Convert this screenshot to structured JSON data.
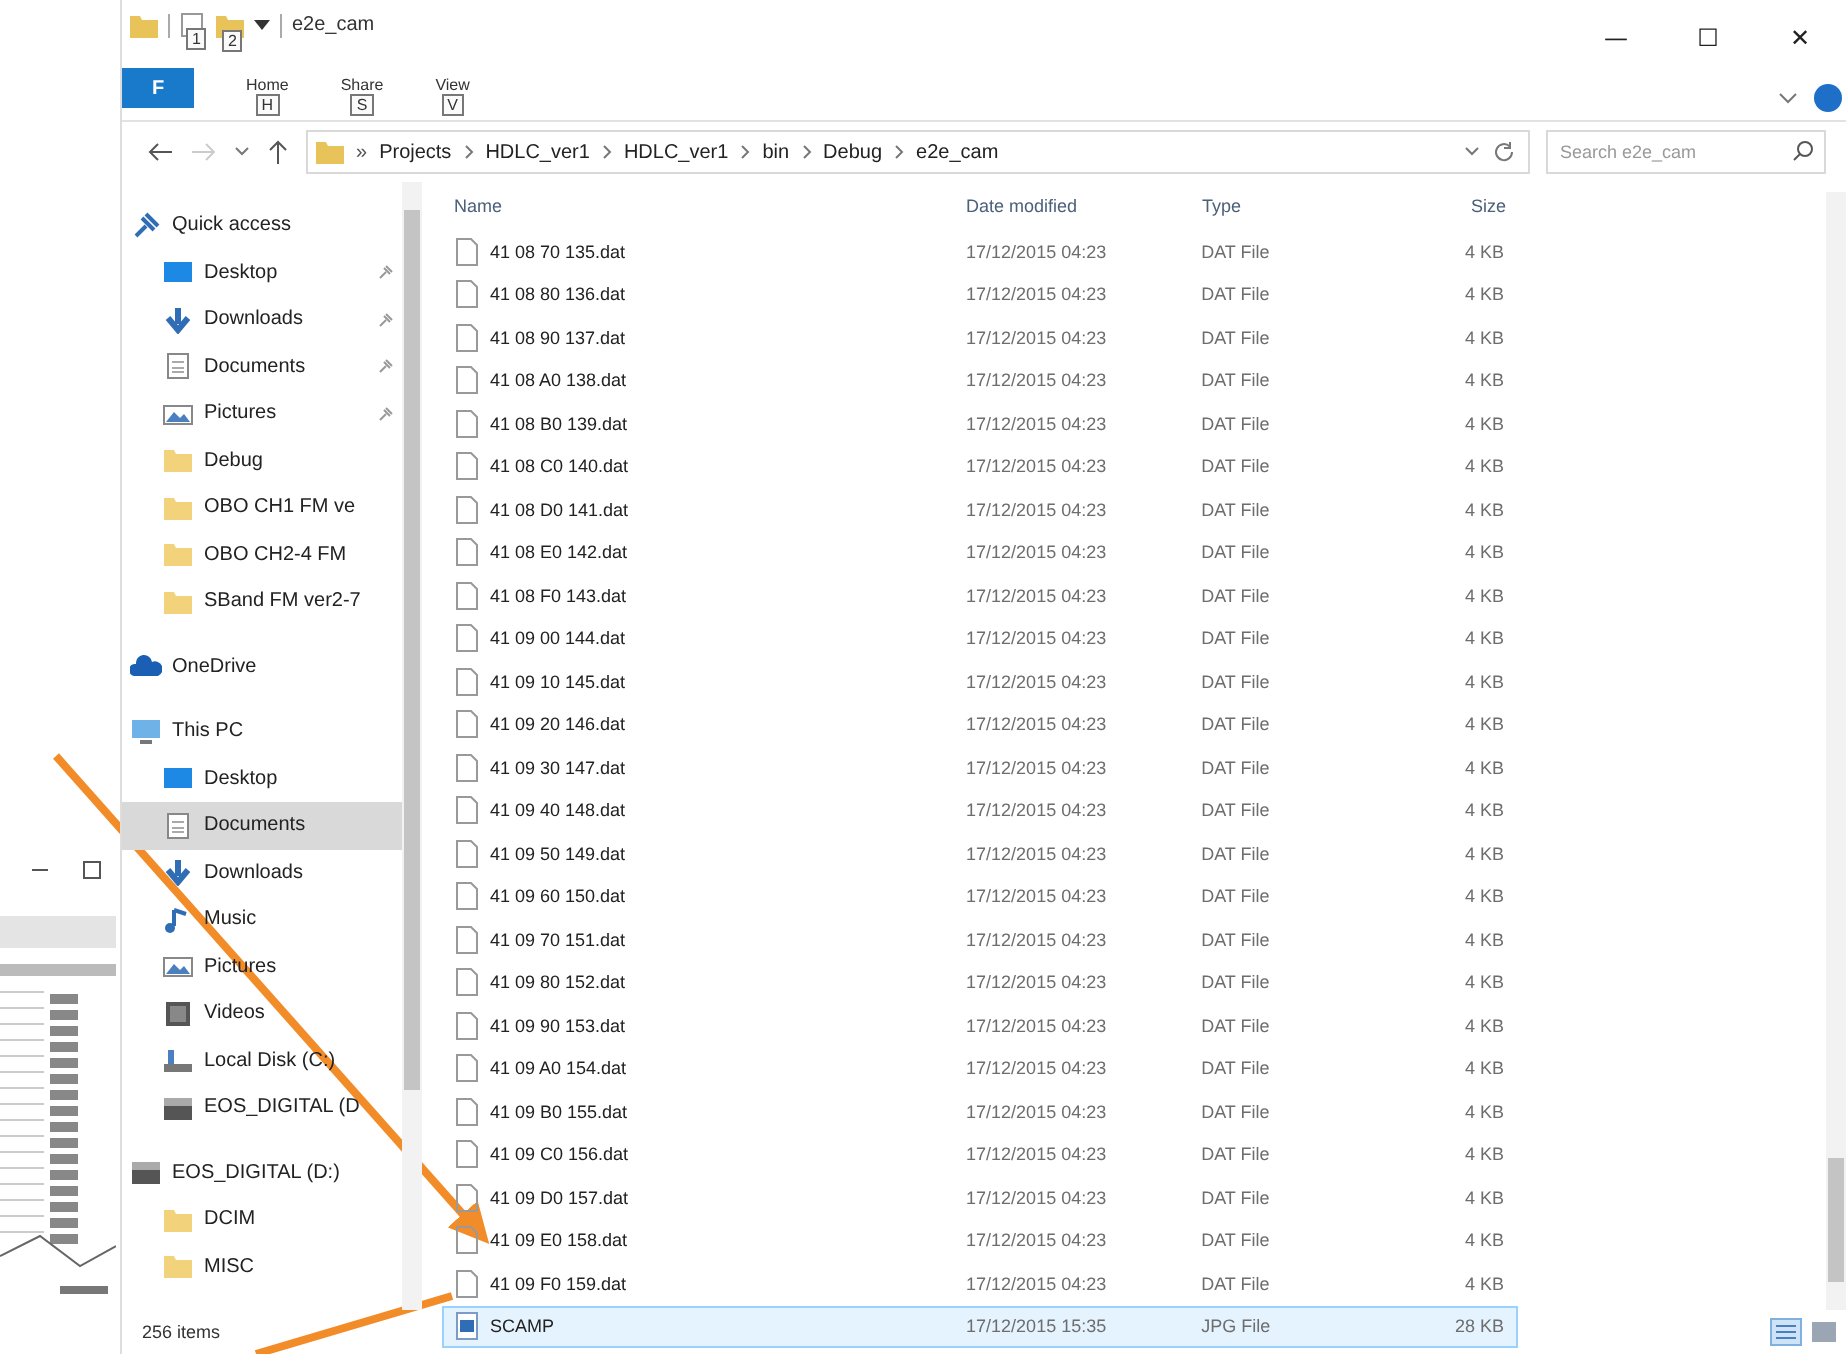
{
  "window": {
    "title": "e2e_cam",
    "controls": [
      "—",
      "☐",
      "✕"
    ]
  },
  "quick_access_keytips": [
    "1",
    "2"
  ],
  "ribbon": {
    "file_tab": {
      "label": "F"
    },
    "tabs": [
      {
        "label": "Home",
        "keytip": "H"
      },
      {
        "label": "Share",
        "keytip": "S"
      },
      {
        "label": "View",
        "keytip": "V"
      }
    ]
  },
  "address_bar": {
    "overflow": "»",
    "crumbs": [
      "Projects",
      "HDLC_ver1",
      "HDLC_ver1",
      "bin",
      "Debug",
      "e2e_cam"
    ]
  },
  "search": {
    "placeholder": "Search e2e_cam"
  },
  "sidebar": {
    "groups": [
      {
        "label": "Quick access",
        "kind": "star",
        "children": [
          {
            "label": "Desktop",
            "kind": "desktop",
            "pinned": true,
            "selected": false
          },
          {
            "label": "Downloads",
            "kind": "download",
            "pinned": true,
            "selected": false
          },
          {
            "label": "Documents",
            "kind": "documents",
            "pinned": true,
            "selected": false
          },
          {
            "label": "Pictures",
            "kind": "pictures",
            "pinned": true,
            "selected": false
          },
          {
            "label": "Debug",
            "kind": "folder",
            "pinned": false,
            "selected": false
          },
          {
            "label": "OBO CH1 FM ve",
            "kind": "folder",
            "pinned": false,
            "selected": false
          },
          {
            "label": "OBO CH2-4 FM",
            "kind": "folder",
            "pinned": false,
            "selected": false
          },
          {
            "label": "SBand FM ver2-7",
            "kind": "folder",
            "pinned": false,
            "selected": false
          }
        ]
      },
      {
        "label": "OneDrive",
        "kind": "cloud"
      },
      {
        "label": "This PC",
        "kind": "pc",
        "children": [
          {
            "label": "Desktop",
            "kind": "desktop",
            "pinned": false,
            "selected": false
          },
          {
            "label": "Documents",
            "kind": "documents",
            "pinned": false,
            "selected": true
          },
          {
            "label": "Downloads",
            "kind": "download",
            "pinned": false,
            "selected": false
          },
          {
            "label": "Music",
            "kind": "music",
            "pinned": false,
            "selected": false
          },
          {
            "label": "Pictures",
            "kind": "pictures",
            "pinned": false,
            "selected": false
          },
          {
            "label": "Videos",
            "kind": "videos",
            "pinned": false,
            "selected": false
          },
          {
            "label": "Local Disk (C:)",
            "kind": "disk",
            "pinned": false,
            "selected": false
          },
          {
            "label": "EOS_DIGITAL (D",
            "kind": "drive",
            "pinned": false,
            "selected": false
          }
        ]
      },
      {
        "label": "EOS_DIGITAL (D:)",
        "kind": "drive",
        "children": [
          {
            "label": "DCIM",
            "kind": "folder",
            "pinned": false,
            "selected": false
          },
          {
            "label": "MISC",
            "kind": "folder",
            "pinned": false,
            "selected": false
          }
        ]
      }
    ]
  },
  "table": {
    "columns": [
      "Name",
      "Date modified",
      "Type",
      "Size"
    ],
    "rows": [
      {
        "name": "41 08 70 135.dat",
        "date": "17/12/2015 04:23",
        "type": "DAT File",
        "size": "4 KB",
        "kind": "file",
        "selected": false
      },
      {
        "name": "41 08 80 136.dat",
        "date": "17/12/2015 04:23",
        "type": "DAT File",
        "size": "4 KB",
        "kind": "file",
        "selected": false
      },
      {
        "name": "41 08 90 137.dat",
        "date": "17/12/2015 04:23",
        "type": "DAT File",
        "size": "4 KB",
        "kind": "file",
        "selected": false
      },
      {
        "name": "41 08 A0 138.dat",
        "date": "17/12/2015 04:23",
        "type": "DAT File",
        "size": "4 KB",
        "kind": "file",
        "selected": false
      },
      {
        "name": "41 08 B0 139.dat",
        "date": "17/12/2015 04:23",
        "type": "DAT File",
        "size": "4 KB",
        "kind": "file",
        "selected": false
      },
      {
        "name": "41 08 C0 140.dat",
        "date": "17/12/2015 04:23",
        "type": "DAT File",
        "size": "4 KB",
        "kind": "file",
        "selected": false
      },
      {
        "name": "41 08 D0 141.dat",
        "date": "17/12/2015 04:23",
        "type": "DAT File",
        "size": "4 KB",
        "kind": "file",
        "selected": false
      },
      {
        "name": "41 08 E0 142.dat",
        "date": "17/12/2015 04:23",
        "type": "DAT File",
        "size": "4 KB",
        "kind": "file",
        "selected": false
      },
      {
        "name": "41 08 F0 143.dat",
        "date": "17/12/2015 04:23",
        "type": "DAT File",
        "size": "4 KB",
        "kind": "file",
        "selected": false
      },
      {
        "name": "41 09 00 144.dat",
        "date": "17/12/2015 04:23",
        "type": "DAT File",
        "size": "4 KB",
        "kind": "file",
        "selected": false
      },
      {
        "name": "41 09 10 145.dat",
        "date": "17/12/2015 04:23",
        "type": "DAT File",
        "size": "4 KB",
        "kind": "file",
        "selected": false
      },
      {
        "name": "41 09 20 146.dat",
        "date": "17/12/2015 04:23",
        "type": "DAT File",
        "size": "4 KB",
        "kind": "file",
        "selected": false
      },
      {
        "name": "41 09 30 147.dat",
        "date": "17/12/2015 04:23",
        "type": "DAT File",
        "size": "4 KB",
        "kind": "file",
        "selected": false
      },
      {
        "name": "41 09 40 148.dat",
        "date": "17/12/2015 04:23",
        "type": "DAT File",
        "size": "4 KB",
        "kind": "file",
        "selected": false
      },
      {
        "name": "41 09 50 149.dat",
        "date": "17/12/2015 04:23",
        "type": "DAT File",
        "size": "4 KB",
        "kind": "file",
        "selected": false
      },
      {
        "name": "41 09 60 150.dat",
        "date": "17/12/2015 04:23",
        "type": "DAT File",
        "size": "4 KB",
        "kind": "file",
        "selected": false
      },
      {
        "name": "41 09 70 151.dat",
        "date": "17/12/2015 04:23",
        "type": "DAT File",
        "size": "4 KB",
        "kind": "file",
        "selected": false
      },
      {
        "name": "41 09 80 152.dat",
        "date": "17/12/2015 04:23",
        "type": "DAT File",
        "size": "4 KB",
        "kind": "file",
        "selected": false
      },
      {
        "name": "41 09 90 153.dat",
        "date": "17/12/2015 04:23",
        "type": "DAT File",
        "size": "4 KB",
        "kind": "file",
        "selected": false
      },
      {
        "name": "41 09 A0 154.dat",
        "date": "17/12/2015 04:23",
        "type": "DAT File",
        "size": "4 KB",
        "kind": "file",
        "selected": false
      },
      {
        "name": "41 09 B0 155.dat",
        "date": "17/12/2015 04:23",
        "type": "DAT File",
        "size": "4 KB",
        "kind": "file",
        "selected": false
      },
      {
        "name": "41 09 C0 156.dat",
        "date": "17/12/2015 04:23",
        "type": "DAT File",
        "size": "4 KB",
        "kind": "file",
        "selected": false
      },
      {
        "name": "41 09 D0 157.dat",
        "date": "17/12/2015 04:23",
        "type": "DAT File",
        "size": "4 KB",
        "kind": "file",
        "selected": false
      },
      {
        "name": "41 09 E0 158.dat",
        "date": "17/12/2015 04:23",
        "type": "DAT File",
        "size": "4 KB",
        "kind": "file",
        "selected": false
      },
      {
        "name": "41 09 F0 159.dat",
        "date": "17/12/2015 04:23",
        "type": "DAT File",
        "size": "4 KB",
        "kind": "file",
        "selected": false
      },
      {
        "name": "SCAMP",
        "date": "17/12/2015 15:35",
        "type": "JPG File",
        "size": "28 KB",
        "kind": "image",
        "selected": true
      }
    ]
  },
  "status_bar": {
    "item_count": "256 items"
  }
}
